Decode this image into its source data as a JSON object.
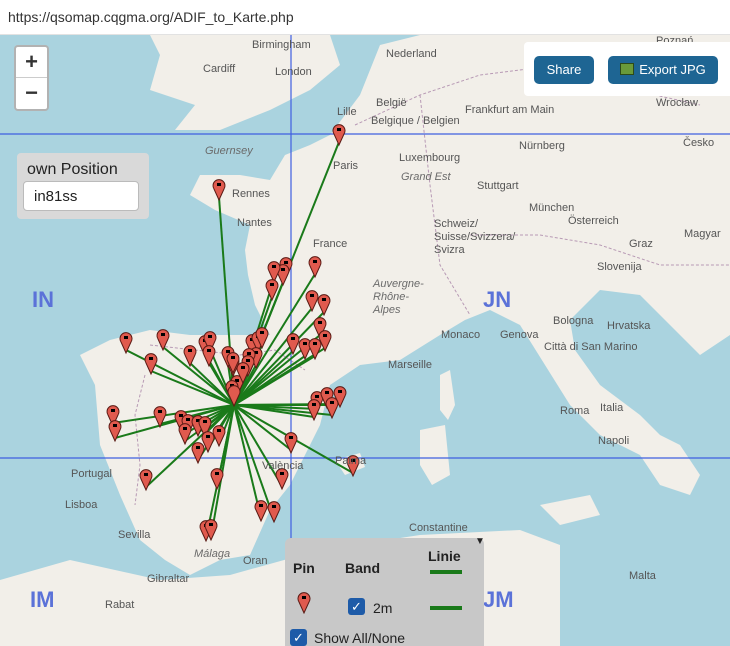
{
  "browser": {
    "url": "https://qsomap.cqgma.org/ADIF_to_Karte.php"
  },
  "zoom": {
    "in_label": "+",
    "out_label": "−"
  },
  "controls": {
    "share_label": "Share",
    "export_label": "Export JPG"
  },
  "own_position": {
    "label": "own Position",
    "locator": "in81ss"
  },
  "grid_labels": [
    "IN",
    "JN",
    "IM",
    "JM"
  ],
  "place_labels": [
    "Birmingham",
    "Cardiff",
    "London",
    "Nederland",
    "Poznań",
    "Wrocław",
    "Lille",
    "België",
    "Belgique / Belgien",
    "Frankfurt am Main",
    "Česko",
    "Guernsey",
    "Paris",
    "Luxembourg",
    "Nürnberg",
    "Grand Est",
    "Stuttgart",
    "Rennes",
    "München",
    "Nantes",
    "Österreich",
    "France",
    "Schweiz/ Suisse/Svizzera/ Svizra",
    "Graz",
    "Magyar",
    "Slovenija",
    "Auvergne- Rhône-Alpes",
    "Monaco",
    "Genova",
    "Bologna",
    "Hrvatska",
    "Marseille",
    "Città di San Marino",
    "Roma",
    "Italia",
    "Napoli",
    "Portugal",
    "Lisboa",
    "València",
    "Palma",
    "Sevilla",
    "Málaga",
    "Gibraltar",
    "Oran",
    "Constantine",
    "Rabat",
    "Malta"
  ],
  "legend": {
    "pin_header": "Pin",
    "band_header": "Band",
    "line_header": "Linie",
    "rows": [
      {
        "band": "2m",
        "checked": true
      }
    ],
    "show_all_label": "Show All/None"
  },
  "colors": {
    "pin": "#e05a4e",
    "line": "#1a7a1a",
    "grid": "#4060e0",
    "button": "#1e6593",
    "sea": "#aad3df",
    "land": "#f2efe9"
  }
}
